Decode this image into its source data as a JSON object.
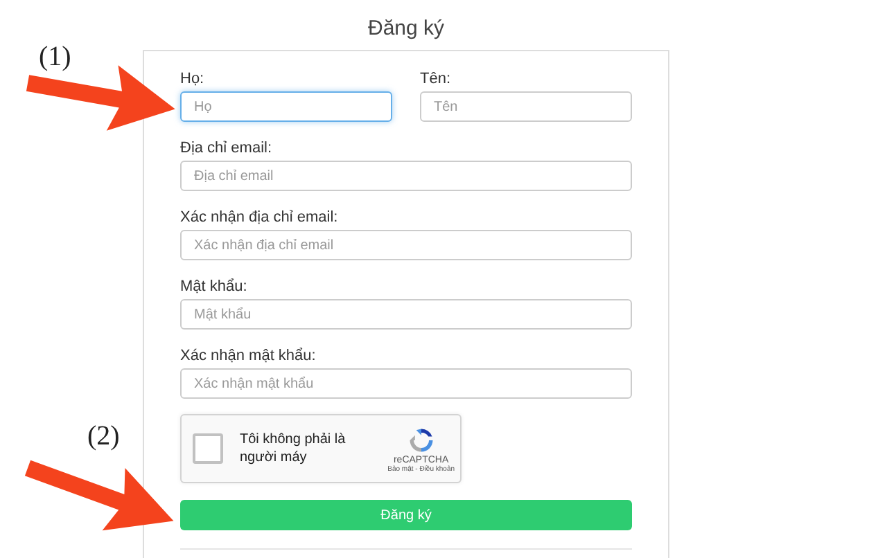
{
  "title": "Đăng ký",
  "rows": [
    [
      {
        "label": "Họ:",
        "placeholder": "Họ",
        "focused": true
      },
      {
        "label": "Tên:",
        "placeholder": "Tên",
        "focused": false
      }
    ],
    [
      {
        "label": "Địa chỉ email:",
        "placeholder": "Địa chỉ email",
        "focused": false
      }
    ],
    [
      {
        "label": "Xác nhận địa chỉ email:",
        "placeholder": "Xác nhận địa chỉ email",
        "focused": false
      }
    ],
    [
      {
        "label": "Mật khẩu:",
        "placeholder": "Mật khẩu",
        "focused": false
      }
    ],
    [
      {
        "label": "Xác nhận mật khẩu:",
        "placeholder": "Xác nhận mật khẩu",
        "focused": false
      }
    ]
  ],
  "captcha": {
    "label": "Tôi không phải là người máy",
    "brand": "reCAPTCHA",
    "links": "Bảo mật - Điều khoản",
    "checked": false
  },
  "submit": "Đăng ký",
  "annotations": [
    {
      "text": "(1)"
    },
    {
      "text": "(2)"
    }
  ]
}
